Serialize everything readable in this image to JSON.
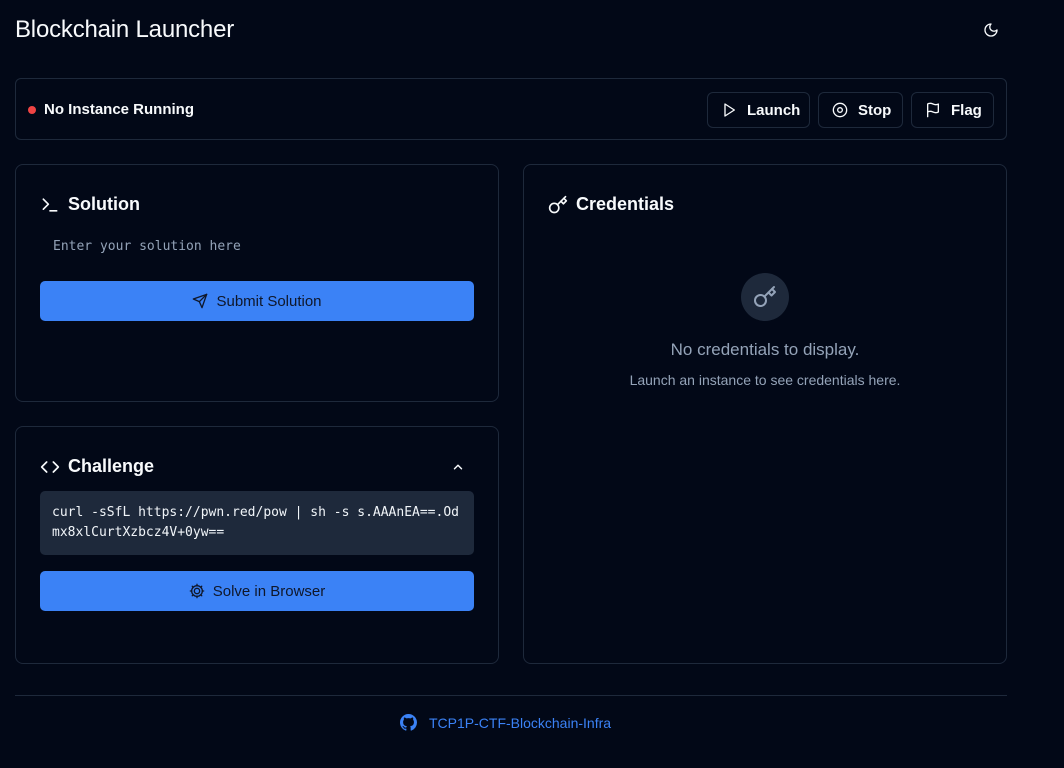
{
  "header": {
    "title": "Blockchain Launcher",
    "theme_icon": "moon-icon"
  },
  "status": {
    "text": "No Instance Running",
    "indicator_color": "#ef4444",
    "actions": [
      {
        "label": "Launch",
        "icon": "play-icon"
      },
      {
        "label": "Stop",
        "icon": "stop-circle-icon"
      },
      {
        "label": "Flag",
        "icon": "flag-icon"
      }
    ]
  },
  "solution": {
    "title": "Solution",
    "icon": "terminal-icon",
    "input_value": "",
    "input_placeholder": "Enter your solution here",
    "submit_label": "Submit Solution",
    "submit_icon": "send-icon"
  },
  "challenge": {
    "title": "Challenge",
    "icon": "code-icon",
    "collapse_icon": "chevron-up-icon",
    "command": "curl -sSfL https://pwn.red/pow | sh -s s.AAAnEA==.Odmx8xlCurtXzbcz4V+0yw==",
    "solve_label": "Solve in Browser",
    "solve_icon": "cog-icon"
  },
  "credentials": {
    "title": "Credentials",
    "icon": "key-icon",
    "empty_title": "No credentials to display.",
    "empty_subtitle": "Launch an instance to see credentials here."
  },
  "footer": {
    "link_label": "TCP1P-CTF-Blockchain-Infra",
    "link_icon": "github-icon"
  },
  "colors": {
    "background": "#020817",
    "border": "#1e293b",
    "accent": "#3b82f6",
    "muted_text": "#94a3b8",
    "danger": "#ef4444"
  }
}
